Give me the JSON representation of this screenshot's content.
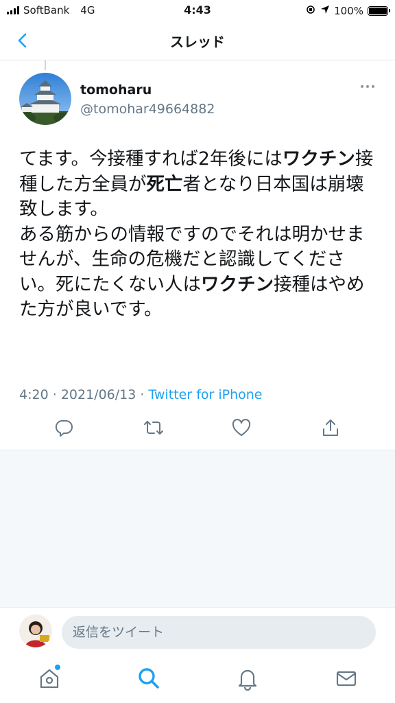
{
  "status_bar": {
    "carrier": "SoftBank",
    "network": "4G",
    "time": "4:43",
    "battery": "100%"
  },
  "header": {
    "title": "スレッド"
  },
  "tweet": {
    "display_name": "tomoharu",
    "handle": "@tomohar49664882",
    "text_segments": [
      {
        "text": "てます。今接種すれば2年後には",
        "bold": false
      },
      {
        "text": "ワクチン",
        "bold": true
      },
      {
        "text": "接種した方全員が",
        "bold": false
      },
      {
        "text": "死亡",
        "bold": true
      },
      {
        "text": "者となり日本国は崩壊致します。",
        "bold": false
      },
      {
        "text": "\n",
        "bold": false
      },
      {
        "text": "ある筋からの情報ですのでそれは明かせませんが、生命の危機だと認識してください。死にたくない人は",
        "bold": false
      },
      {
        "text": "ワクチン",
        "bold": true
      },
      {
        "text": "接種はやめた方が良いです。",
        "bold": false
      }
    ],
    "time": "4:20",
    "separator": "·",
    "date": "2021/06/13",
    "source": "Twitter for iPhone"
  },
  "actions": [
    "reply-icon",
    "retweet-icon",
    "like-icon",
    "share-icon"
  ],
  "reply": {
    "placeholder": "返信をツイート"
  },
  "tabs": [
    "home-icon",
    "search-icon",
    "notifications-icon",
    "messages-icon"
  ],
  "colors": {
    "accent": "#1da1f2",
    "secondary_text": "#657786",
    "border": "#e1e8ed"
  }
}
